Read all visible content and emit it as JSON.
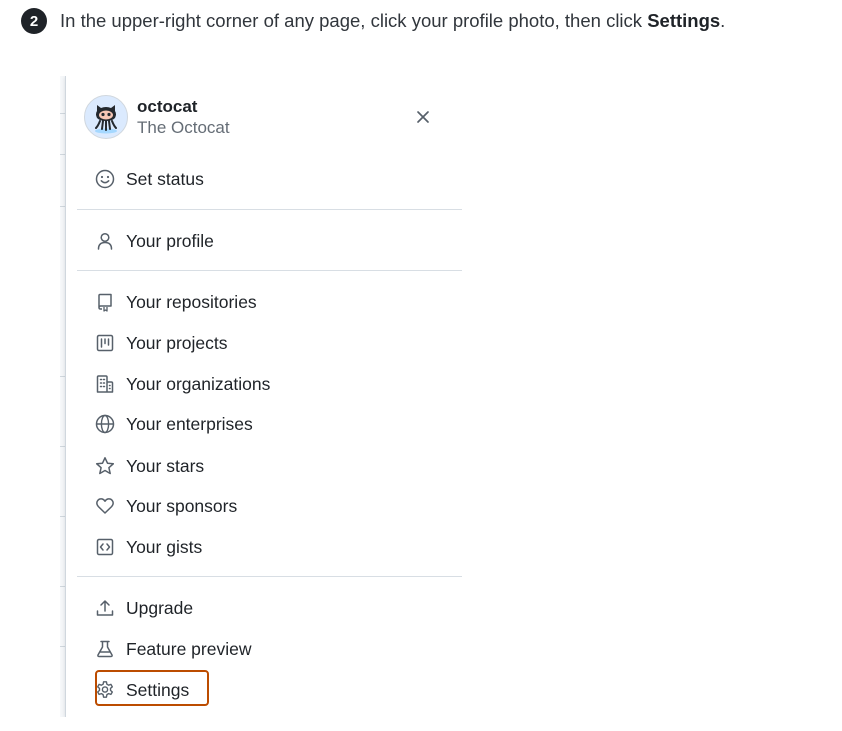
{
  "instruction": {
    "step_number": "2",
    "text_before": "In the upper-right corner of any page, click your profile photo, then click ",
    "text_bold": "Settings",
    "text_after": "."
  },
  "user": {
    "login": "octocat",
    "name": "The Octocat"
  },
  "menu": {
    "set_status": "Set status",
    "your_profile": "Your profile",
    "your_repositories": "Your repositories",
    "your_projects": "Your projects",
    "your_organizations": "Your organizations",
    "your_enterprises": "Your enterprises",
    "your_stars": "Your stars",
    "your_sponsors": "Your sponsors",
    "your_gists": "Your gists",
    "upgrade": "Upgrade",
    "feature_preview": "Feature preview",
    "settings": "Settings"
  },
  "icons": {
    "close": "close-icon",
    "set_status": "smiley-icon",
    "your_profile": "person-icon",
    "your_repositories": "repo-icon",
    "your_projects": "project-icon",
    "your_organizations": "organization-icon",
    "your_enterprises": "globe-icon",
    "your_stars": "star-icon",
    "your_sponsors": "heart-icon",
    "your_gists": "code-square-icon",
    "upgrade": "upload-icon",
    "feature_preview": "beaker-icon",
    "settings": "gear-icon"
  },
  "colors": {
    "highlight": "#bc4c00",
    "step_badge": "#1f2328",
    "muted_text": "#656d76"
  }
}
